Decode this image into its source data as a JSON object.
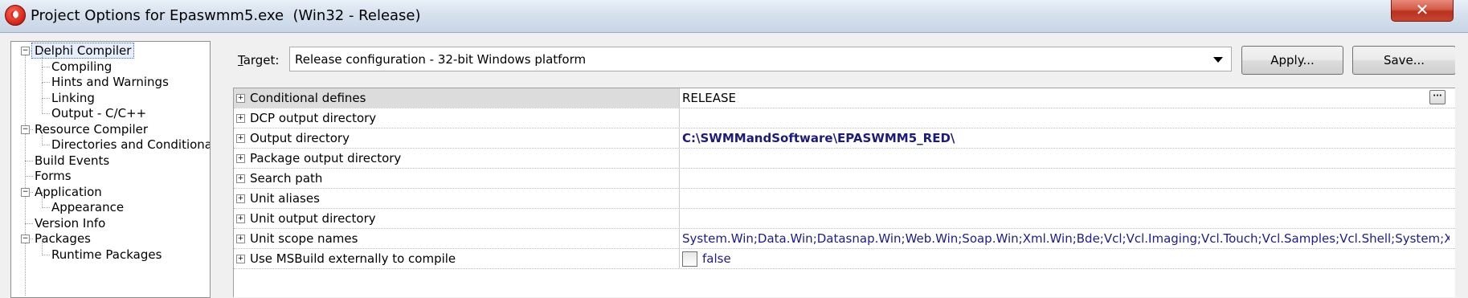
{
  "window": {
    "title": "Project Options for Epaswmm5.exe  (Win32 - Release)",
    "close_glyph": "✕"
  },
  "tree": {
    "items": [
      {
        "label": "Delphi Compiler",
        "level": 0,
        "expander": "⊟",
        "selected": true
      },
      {
        "label": "Compiling",
        "level": 1
      },
      {
        "label": "Hints and Warnings",
        "level": 1
      },
      {
        "label": "Linking",
        "level": 1
      },
      {
        "label": "Output - C/C++",
        "level": 1
      },
      {
        "label": "Resource Compiler",
        "level": 0,
        "expander": "⊟"
      },
      {
        "label": "Directories and Conditionals",
        "level": 1
      },
      {
        "label": "Build Events",
        "level": 0
      },
      {
        "label": "Forms",
        "level": 0
      },
      {
        "label": "Application",
        "level": 0,
        "expander": "⊟"
      },
      {
        "label": "Appearance",
        "level": 1
      },
      {
        "label": "Version Info",
        "level": 0
      },
      {
        "label": "Packages",
        "level": 0,
        "expander": "⊟"
      },
      {
        "label": "Runtime Packages",
        "level": 1
      }
    ]
  },
  "target": {
    "label_accel": "T",
    "label_rest": "arget:",
    "value": "Release configuration - 32-bit Windows platform"
  },
  "buttons": {
    "apply": "Apply...",
    "save": "Save..."
  },
  "grid": {
    "rows": [
      {
        "name": "Conditional defines",
        "value": "RELEASE",
        "style": "plain",
        "selected": true,
        "ellipsis": "···"
      },
      {
        "name": "DCP output directory",
        "value": "",
        "style": "plain"
      },
      {
        "name": "Output directory",
        "value": "C:\\SWMMandSoftware\\EPASWMM5_RED\\",
        "style": "bold"
      },
      {
        "name": "Package output directory",
        "value": "",
        "style": "plain"
      },
      {
        "name": "Search path",
        "value": "",
        "style": "plain"
      },
      {
        "name": "Unit aliases",
        "value": "",
        "style": "plain"
      },
      {
        "name": "Unit output directory",
        "value": "",
        "style": "plain"
      },
      {
        "name": "Unit scope names",
        "value": "System.Win;Data.Win;Datasnap.Win;Web.Win;Soap.Win;Xml.Win;Bde;Vcl;Vcl.Imaging;Vcl.Touch;Vcl.Samples;Vcl.Shell;System;Xml;",
        "style": "blue"
      },
      {
        "name": "Use MSBuild externally to compile",
        "value": "false",
        "style": "checkbox",
        "checked": false
      }
    ],
    "expander_glyph": "⊞"
  }
}
